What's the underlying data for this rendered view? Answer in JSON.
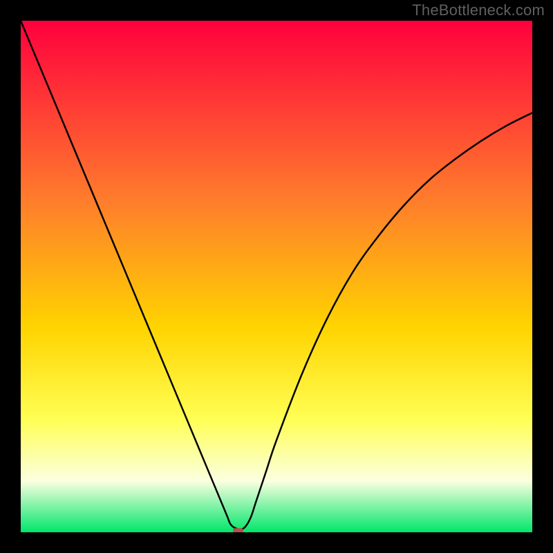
{
  "watermark": "TheBottleneck.com",
  "colors": {
    "gradient_top": "#ff003d",
    "gradient_mid1": "#ff7c2c",
    "gradient_mid2": "#ffd400",
    "gradient_mid3": "#ffff55",
    "gradient_mid4": "#fbffe0",
    "gradient_bottom": "#00e66a",
    "curve": "#000000",
    "marker": "#b3524b",
    "frame": "#000000"
  },
  "chart_data": {
    "type": "line",
    "title": "",
    "xlabel": "",
    "ylabel": "",
    "xlim": [
      0,
      100
    ],
    "ylim": [
      0,
      100
    ],
    "series": [
      {
        "name": "bottleneck-curve",
        "x": [
          0,
          5,
          10,
          15,
          20,
          25,
          30,
          35,
          40,
          41,
          42,
          43,
          44,
          45,
          46,
          48,
          50,
          55,
          60,
          65,
          70,
          75,
          80,
          85,
          90,
          95,
          100
        ],
        "values": [
          100,
          88,
          76,
          64,
          52,
          40,
          28,
          16,
          4,
          1.6,
          0.8,
          0.5,
          1.2,
          3,
          6,
          12,
          18,
          31,
          42,
          51,
          58,
          64,
          69,
          73,
          76.5,
          79.5,
          82
        ]
      }
    ],
    "marker": {
      "x": 42.5,
      "y": 0.2,
      "width": 2.0,
      "height": 1.2
    },
    "gradient_stops": [
      {
        "offset": 0.0,
        "color": "#ff003d"
      },
      {
        "offset": 0.35,
        "color": "#ff7c2c"
      },
      {
        "offset": 0.6,
        "color": "#ffd400"
      },
      {
        "offset": 0.78,
        "color": "#ffff55"
      },
      {
        "offset": 0.9,
        "color": "#fbffe0"
      },
      {
        "offset": 1.0,
        "color": "#00e66a"
      }
    ]
  }
}
